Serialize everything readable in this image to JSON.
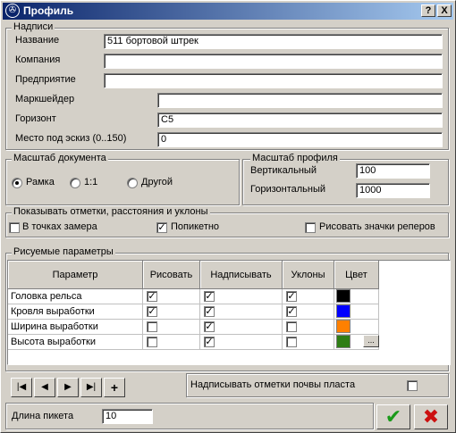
{
  "window": {
    "title": "Профиль",
    "help_btn": "?",
    "close_btn": "X"
  },
  "labels_group": {
    "legend": "Надписи",
    "fields": [
      {
        "label": "Название",
        "value": "511 бортовой штрек"
      },
      {
        "label": "Компания",
        "value": ""
      },
      {
        "label": "Предприятие",
        "value": ""
      },
      {
        "label": "Маркшейдер",
        "value": ""
      },
      {
        "label": "Горизонт",
        "value": "С5"
      },
      {
        "label": "Место под эскиз (0..150)",
        "value": "0"
      }
    ]
  },
  "doc_scale": {
    "legend": "Масштаб документа",
    "options": [
      "Рамка",
      "1:1",
      "Другой"
    ],
    "selected": "Рамка"
  },
  "profile_scale": {
    "legend": "Масштаб профиля",
    "vertical_label": "Вертикальный",
    "vertical_value": "100",
    "horizontal_label": "Горизонтальный",
    "horizontal_value": "1000"
  },
  "marks": {
    "legend": "Показывать отметки, расстояния и уклоны",
    "options": [
      {
        "label": "В точках замера",
        "checked": false
      },
      {
        "label": "Попикетно",
        "checked": true
      },
      {
        "label": "Рисовать значки реперов",
        "checked": false
      }
    ]
  },
  "params": {
    "legend": "Рисуемые параметры",
    "columns": [
      "Параметр",
      "Рисовать",
      "Надписывать",
      "Уклоны",
      "Цвет"
    ],
    "rows": [
      {
        "name": "Головка рельса",
        "draw": true,
        "label": true,
        "slope": true,
        "color": "#000000"
      },
      {
        "name": "Кровля выработки",
        "draw": true,
        "label": true,
        "slope": true,
        "color": "#0000ff"
      },
      {
        "name": "Ширина выработки",
        "draw": false,
        "label": true,
        "slope": false,
        "color": "#ff8000"
      },
      {
        "name": "Высота выработки",
        "draw": false,
        "label": true,
        "slope": false,
        "color": "#2e7d14"
      }
    ],
    "color_picker_label": "...",
    "nav": {
      "first": "|◀",
      "prev": "◀",
      "next": "▶",
      "last": "▶|",
      "add": "+"
    },
    "bottom_option_label": "Надписывать отметки почвы пласта",
    "bottom_option_checked": false
  },
  "footer": {
    "picket_label": "Длина пикета",
    "picket_value": "10",
    "ok": "✔",
    "cancel": "✖"
  },
  "colors": {
    "ok_green": "#1a9a1a",
    "cancel_red": "#cc1010"
  }
}
